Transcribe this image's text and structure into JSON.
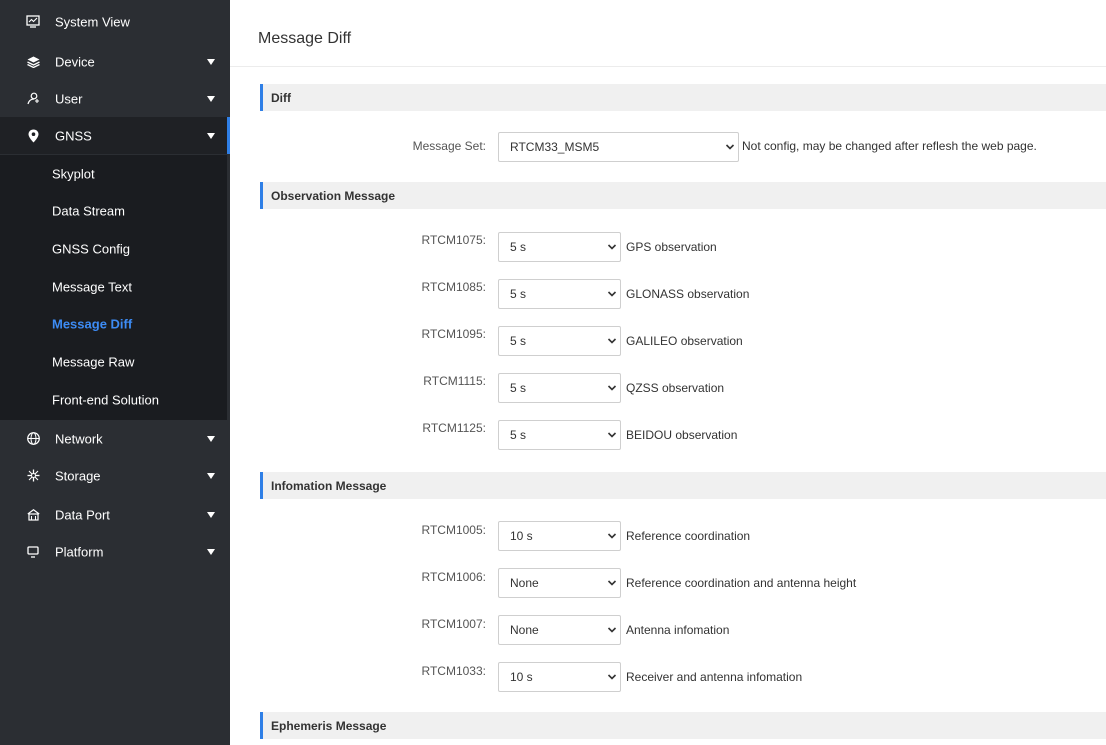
{
  "sidebar": {
    "items": [
      {
        "label": "System View",
        "icon": "monitor-icon"
      },
      {
        "label": "Device",
        "icon": "layers-icon"
      },
      {
        "label": "User",
        "icon": "user-icon"
      },
      {
        "label": "GNSS",
        "icon": "location-pin-icon"
      },
      {
        "label": "Network",
        "icon": "globe-icon"
      },
      {
        "label": "Storage",
        "icon": "storage-icon"
      },
      {
        "label": "Data Port",
        "icon": "data-port-icon"
      },
      {
        "label": "Platform",
        "icon": "platform-icon"
      }
    ],
    "gnss_sub_items": [
      {
        "label": "Skyplot"
      },
      {
        "label": "Data Stream"
      },
      {
        "label": "GNSS Config"
      },
      {
        "label": "Message Text"
      },
      {
        "label": "Message Diff"
      },
      {
        "label": "Message Raw"
      },
      {
        "label": "Front-end Solution"
      }
    ],
    "active_sub_item": "Message Diff"
  },
  "page": {
    "title": "Message Diff"
  },
  "sections": {
    "diff": {
      "title": "Diff",
      "message_set_label": "Message Set:",
      "message_set_value": "RTCM33_MSM5",
      "message_set_note": "Not config, may be changed after reflesh the web page."
    },
    "observation": {
      "title": "Observation Message",
      "rows": [
        {
          "label": "RTCM1075:",
          "value": "5 s",
          "desc": "GPS observation"
        },
        {
          "label": "RTCM1085:",
          "value": "5 s",
          "desc": "GLONASS observation"
        },
        {
          "label": "RTCM1095:",
          "value": "5 s",
          "desc": "GALILEO observation"
        },
        {
          "label": "RTCM1115:",
          "value": "5 s",
          "desc": "QZSS observation"
        },
        {
          "label": "RTCM1125:",
          "value": "5 s",
          "desc": "BEIDOU observation"
        }
      ]
    },
    "information": {
      "title": "Infomation Message",
      "rows": [
        {
          "label": "RTCM1005:",
          "value": "10 s",
          "desc": "Reference coordination"
        },
        {
          "label": "RTCM1006:",
          "value": "None",
          "desc": "Reference coordination and antenna height"
        },
        {
          "label": "RTCM1007:",
          "value": "None",
          "desc": "Antenna infomation"
        },
        {
          "label": "RTCM1033:",
          "value": "10 s",
          "desc": "Receiver and antenna infomation"
        }
      ]
    },
    "ephemeris": {
      "title": "Ephemeris Message"
    }
  },
  "colors": {
    "sidebar_bg": "#2b2e33",
    "submenu_bg": "#1a1c20",
    "accent": "#2f7fe6",
    "active_text": "#3d8cf5",
    "section_bg": "#f0f0f0"
  }
}
